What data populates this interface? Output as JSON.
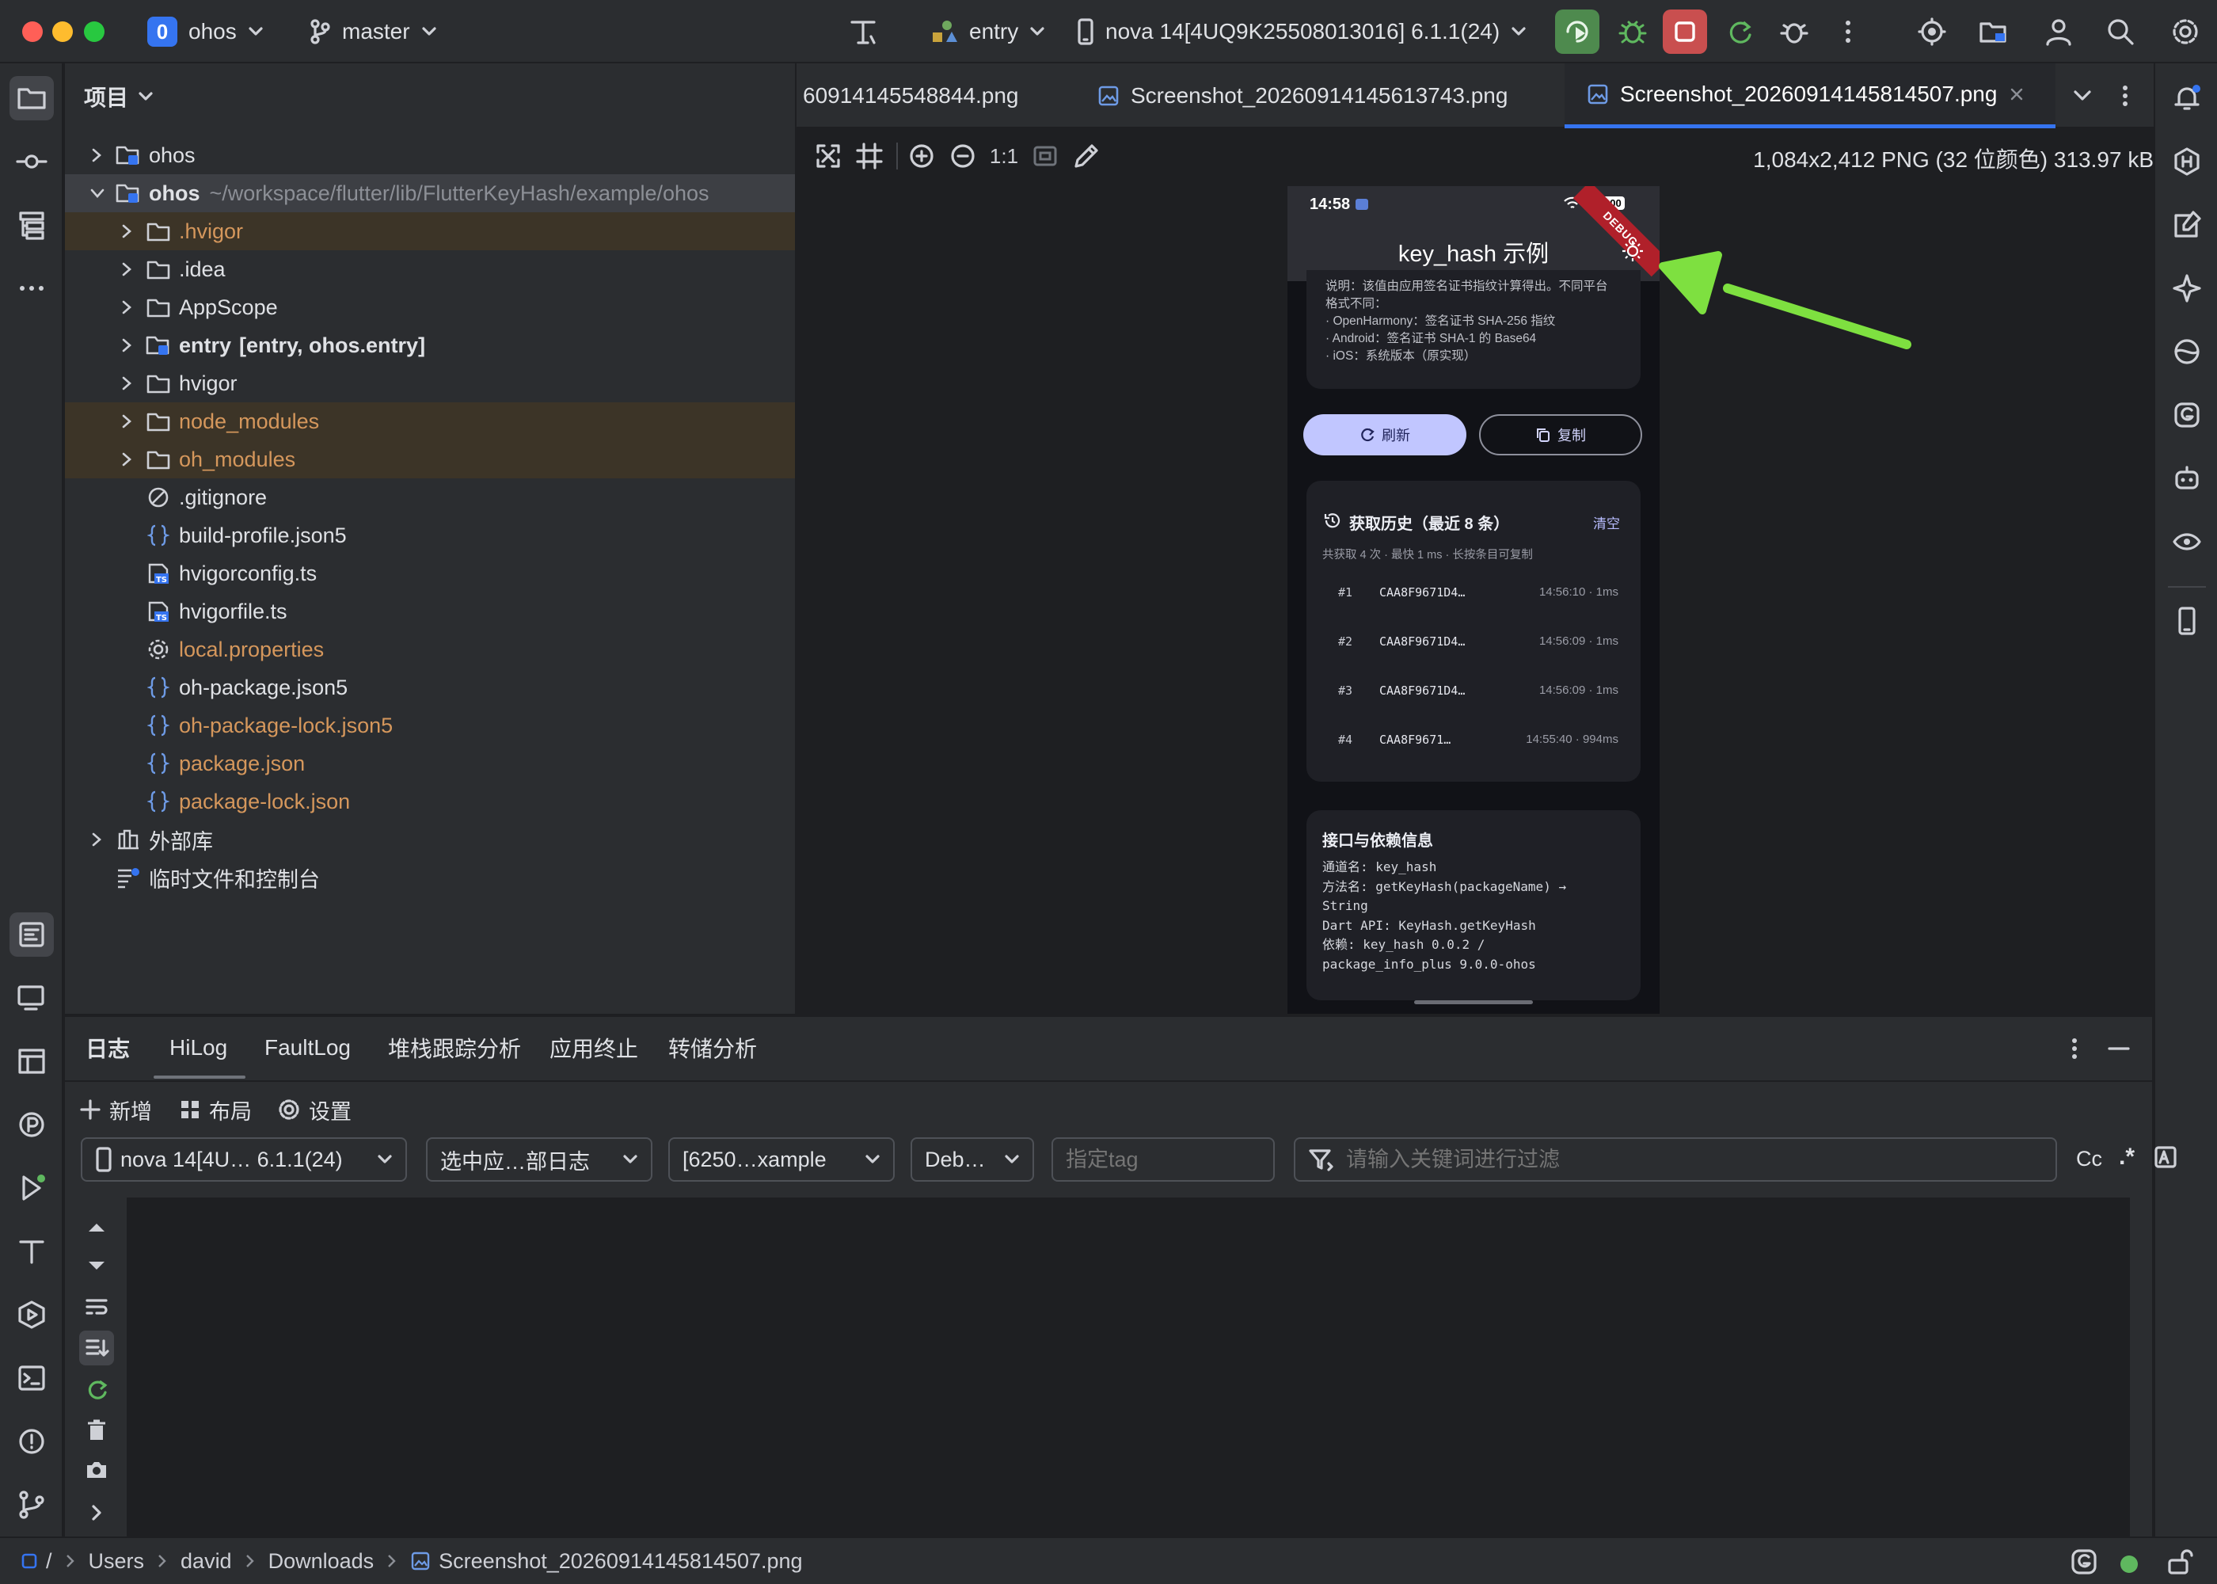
{
  "titlebar": {
    "project_badge": "0",
    "project_name": "ohos",
    "branch": "master",
    "run_config": "entry",
    "device": "nova 14[4UQ9K25508013016] 6.1.1(24)"
  },
  "colors": {
    "accent": "#3574f0",
    "run_green": "#4e8a4e",
    "stop_red": "#c94f4f",
    "folder_orange": "#d5975c",
    "arrow_green": "#7ee040"
  },
  "project_panel": {
    "title": "项目",
    "items": [
      {
        "label": "ohos",
        "extra": "",
        "path": "",
        "icon": "module-icon",
        "level": 0,
        "chevron": "right",
        "style": "normal"
      },
      {
        "label": "ohos",
        "extra": "",
        "path": "~/workspace/flutter/lib/FlutterKeyHash/example/ohos",
        "icon": "module-icon",
        "level": 0,
        "chevron": "down",
        "style": "selected"
      },
      {
        "label": ".hvigor",
        "extra": "",
        "path": "",
        "icon": "folder-icon",
        "level": 1,
        "chevron": "right",
        "style": "excluded"
      },
      {
        "label": ".idea",
        "extra": "",
        "path": "",
        "icon": "folder-icon",
        "level": 1,
        "chevron": "right",
        "style": "normal"
      },
      {
        "label": "AppScope",
        "extra": "",
        "path": "",
        "icon": "folder-icon",
        "level": 1,
        "chevron": "right",
        "style": "normal"
      },
      {
        "label": "entry",
        "extra": "[entry, ohos.entry]",
        "path": "",
        "icon": "module-icon",
        "level": 1,
        "chevron": "right",
        "style": "normal"
      },
      {
        "label": "hvigor",
        "extra": "",
        "path": "",
        "icon": "folder-icon",
        "level": 1,
        "chevron": "right",
        "style": "normal"
      },
      {
        "label": "node_modules",
        "extra": "",
        "path": "",
        "icon": "folder-icon",
        "level": 1,
        "chevron": "right",
        "style": "excluded"
      },
      {
        "label": "oh_modules",
        "extra": "",
        "path": "",
        "icon": "folder-icon",
        "level": 1,
        "chevron": "right",
        "style": "excluded"
      },
      {
        "label": ".gitignore",
        "extra": "",
        "path": "",
        "icon": "ignore-file-icon",
        "level": 1,
        "chevron": "none",
        "style": "normal"
      },
      {
        "label": "build-profile.json5",
        "extra": "",
        "path": "",
        "icon": "json-file-icon",
        "level": 1,
        "chevron": "none",
        "style": "normal"
      },
      {
        "label": "hvigorconfig.ts",
        "extra": "",
        "path": "",
        "icon": "ts-file-icon",
        "level": 1,
        "chevron": "none",
        "style": "normal"
      },
      {
        "label": "hvigorfile.ts",
        "extra": "",
        "path": "",
        "icon": "ts-file-icon",
        "level": 1,
        "chevron": "none",
        "style": "normal"
      },
      {
        "label": "local.properties",
        "extra": "",
        "path": "",
        "icon": "settings-file-icon",
        "level": 1,
        "chevron": "none",
        "style": "orange"
      },
      {
        "label": "oh-package.json5",
        "extra": "",
        "path": "",
        "icon": "json-file-icon",
        "level": 1,
        "chevron": "none",
        "style": "normal"
      },
      {
        "label": "oh-package-lock.json5",
        "extra": "",
        "path": "",
        "icon": "json-file-icon",
        "level": 1,
        "chevron": "none",
        "style": "orange"
      },
      {
        "label": "package.json",
        "extra": "",
        "path": "",
        "icon": "json-file-icon",
        "level": 1,
        "chevron": "none",
        "style": "orange"
      },
      {
        "label": "package-lock.json",
        "extra": "",
        "path": "",
        "icon": "json-file-icon",
        "level": 1,
        "chevron": "none",
        "style": "orange"
      },
      {
        "label": "外部库",
        "extra": "",
        "path": "",
        "icon": "library-icon",
        "level": 0,
        "chevron": "right",
        "style": "normal"
      },
      {
        "label": "临时文件和控制台",
        "extra": "",
        "path": "",
        "icon": "scratch-icon",
        "level": 0,
        "chevron": "none",
        "style": "normal"
      }
    ]
  },
  "editor": {
    "tabs": [
      {
        "label": "60914145548844.png",
        "active": false
      },
      {
        "label": "Screenshot_20260914145613743.png",
        "active": false
      },
      {
        "label": "Screenshot_20260914145814507.png",
        "active": true
      }
    ],
    "image_toolbar": {
      "actual_size_label": "1:1",
      "image_info": "1,084x2,412 PNG (32 位颜色) 313.97 kB"
    }
  },
  "phone": {
    "time": "14:58",
    "battery": "100",
    "debug_banner": "DEBUG",
    "app_title": "key_hash 示例",
    "note_lines": [
      "说明：该值由应用签名证书指纹计算得出。不同平台",
      "格式不同：",
      "· OpenHarmony：签名证书 SHA-256 指纹",
      "· Android：签名证书 SHA-1 的 Base64",
      "· iOS：系统版本（原实现）"
    ],
    "refresh_label": "刷新",
    "copy_label": "复制",
    "history_title": "获取历史（最近 8 条）",
    "clear_label": "清空",
    "history_summary": "共获取 4 次 · 最快 1 ms · 长按条目可复制",
    "history": [
      {
        "index": "#1",
        "hash": "CAA8F9671D4…",
        "meta": "14:56:10 · 1ms"
      },
      {
        "index": "#2",
        "hash": "CAA8F9671D4…",
        "meta": "14:56:09 · 1ms"
      },
      {
        "index": "#3",
        "hash": "CAA8F9671D4…",
        "meta": "14:56:09 · 1ms"
      },
      {
        "index": "#4",
        "hash": "CAA8F9671…",
        "meta": "14:55:40 · 994ms"
      }
    ],
    "info_title": "接口与依赖信息",
    "info_lines": [
      "通道名: key_hash",
      "方法名: getKeyHash(packageName) →",
      "String",
      "Dart API: KeyHash.getKeyHash",
      "依赖: key_hash 0.0.2 /",
      "package_info_plus 9.0.0-ohos"
    ]
  },
  "log_panel": {
    "title": "日志",
    "tabs": [
      "HiLog",
      "FaultLog",
      "堆栈跟踪分析",
      "应用终止",
      "转储分析"
    ],
    "active_tab": "HiLog",
    "add_label": "新增",
    "layout_label": "布局",
    "settings_label": "设置",
    "device_select": "nova 14[4U… 6.1.1(24)",
    "app_select": "选中应…部日志",
    "process_select": "[6250…xample",
    "level_select": "Deb…",
    "tag_placeholder": "指定tag",
    "filter_placeholder": "请输入关键词进行过滤",
    "case_label": "Cc",
    "regex_label": ".*"
  },
  "statusbar": {
    "breadcrumb": [
      "/",
      "Users",
      "david",
      "Downloads",
      "Screenshot_20260914145814507.png"
    ]
  }
}
